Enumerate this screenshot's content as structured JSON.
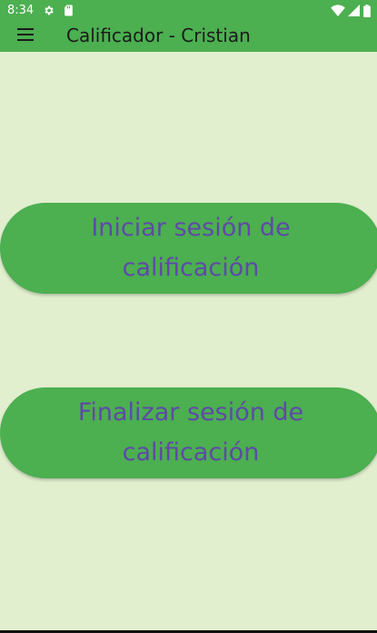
{
  "status_bar": {
    "time": "8:34",
    "icons": [
      "settings-icon",
      "sd-card-icon",
      "wifi-icon",
      "signal-icon",
      "battery-icon"
    ]
  },
  "app_bar": {
    "menu_icon": "hamburger-menu-icon",
    "title": "Calificador - Cristian"
  },
  "actions": {
    "start_session_label": "Iniciar sesión de calificación",
    "end_session_label": "Finalizar sesión de calificación"
  },
  "colors": {
    "primary": "#4CAF50",
    "background": "#E1EFCF",
    "button_text": "#5E4AA8",
    "title_text": "#1B1B1B"
  }
}
